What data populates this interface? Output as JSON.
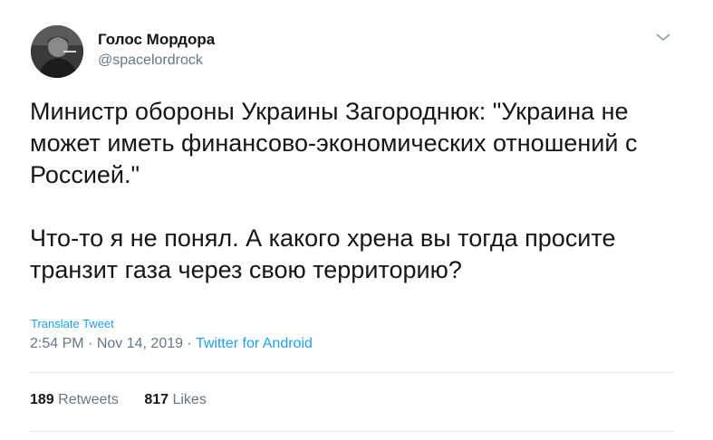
{
  "author": {
    "display_name": "Голос Мордора",
    "handle": "@spacelordrock",
    "avatar_icon": "user-avatar-photo"
  },
  "tweet": {
    "paragraphs": [
      "Министр обороны Украины Загороднюк: \"Украина не может иметь финансово-экономических отношений с Россией.\"",
      "Что-то я не понял. А какого хрена вы тогда просите транзит газа через свою территорию?"
    ]
  },
  "translate_label": "Translate Tweet",
  "meta": {
    "time": "2:54 PM",
    "date": "Nov 14, 2019",
    "separator": "·",
    "source": "Twitter for Android"
  },
  "stats": {
    "retweets_count": "189",
    "retweets_label": "Retweets",
    "likes_count": "817",
    "likes_label": "Likes"
  },
  "colors": {
    "text": "#14171a",
    "secondary": "#657786",
    "link": "#1da1f2",
    "divider": "#e6ecf0"
  },
  "icons": {
    "menu": "chevron-down-icon"
  }
}
